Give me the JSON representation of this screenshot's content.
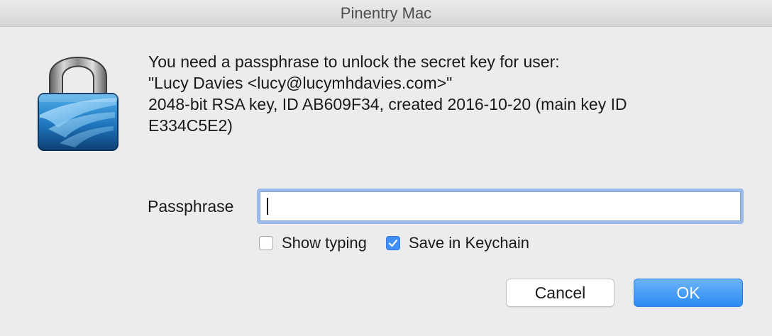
{
  "window": {
    "title": "Pinentry Mac"
  },
  "icon": {
    "name": "padlock-icon"
  },
  "message": {
    "line1": "You need a passphrase to unlock the secret key for user:",
    "line2": "\"Lucy Davies <lucy@lucymhdavies.com>\"",
    "line3": "2048-bit RSA key, ID AB609F34, created 2016-10-20 (main key ID",
    "line4": "E334C5E2)"
  },
  "passphrase": {
    "label": "Passphrase",
    "value": ""
  },
  "options": {
    "show_typing": {
      "label": "Show typing",
      "checked": false
    },
    "save_keychain": {
      "label": "Save in Keychain",
      "checked": true
    }
  },
  "buttons": {
    "cancel": "Cancel",
    "ok": "OK"
  },
  "colors": {
    "accent": "#3e8ff7",
    "focus_ring": "#9dbbe9",
    "lock_blue": "#2b82c6"
  }
}
